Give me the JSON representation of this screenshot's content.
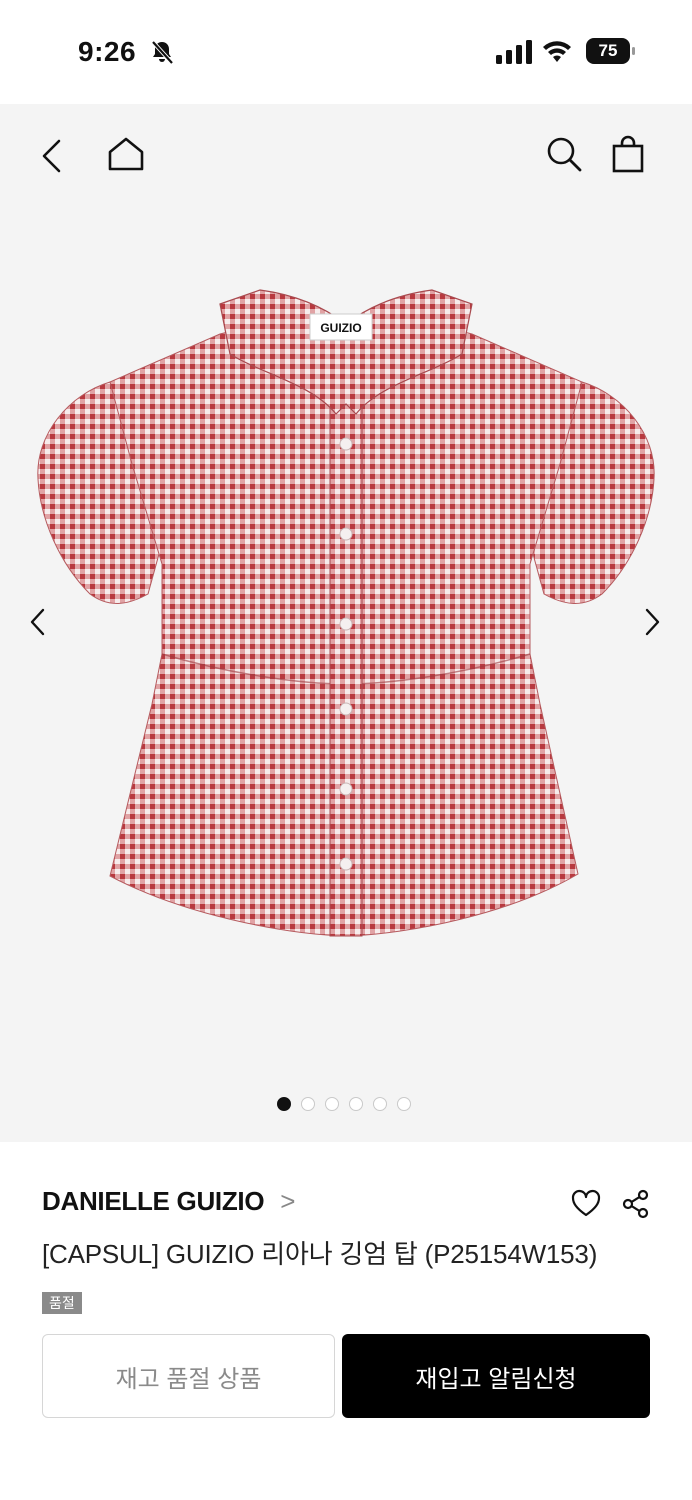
{
  "status_bar": {
    "time": "9:26",
    "battery": "75",
    "icons": [
      "bell-off-icon",
      "signal-icon",
      "wifi-icon",
      "battery-icon"
    ]
  },
  "nav": {
    "icons": [
      "back-icon",
      "home-icon",
      "search-icon",
      "shopping-bag-icon"
    ]
  },
  "gallery": {
    "image_logo_text": "GUIZIO",
    "image_count": 6,
    "active_index": 0,
    "colors": {
      "check_red": "#c94a4f",
      "background": "#f4f4f4"
    }
  },
  "product": {
    "brand": "DANIELLE GUIZIO",
    "brand_chevron": ">",
    "title": "[CAPSUL] GUIZIO 리아나 깅엄 탑 (P25154W153)",
    "badge": "품절"
  },
  "actions": {
    "soldout_label": "재고 품절 상품",
    "restock_label": "재입고 알림신청"
  }
}
